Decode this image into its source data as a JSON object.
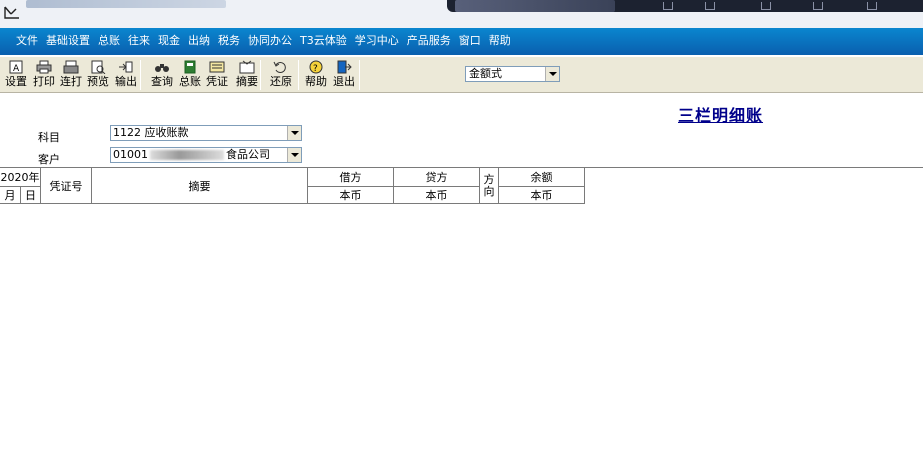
{
  "menu": {
    "items": [
      "文件",
      "基础设置",
      "总账",
      "往来",
      "现金",
      "出纳",
      "税务",
      "协同办公",
      "T3云体验",
      "学习中心",
      "产品服务",
      "窗口",
      "帮助"
    ]
  },
  "toolbar": {
    "buttons": [
      {
        "label": "设置",
        "icon": "settings-icon"
      },
      {
        "label": "打印",
        "icon": "printer-icon"
      },
      {
        "label": "连打",
        "icon": "continuous-print-icon"
      },
      {
        "label": "预览",
        "icon": "preview-icon"
      },
      {
        "label": "输出",
        "icon": "export-icon"
      },
      {
        "label": "查询",
        "icon": "binoculars-icon"
      },
      {
        "label": "总账",
        "icon": "ledger-book-icon"
      },
      {
        "label": "凭证",
        "icon": "voucher-icon"
      },
      {
        "label": "摘要",
        "icon": "summary-icon"
      },
      {
        "label": "还原",
        "icon": "restore-icon"
      },
      {
        "label": "帮助",
        "icon": "help-icon"
      },
      {
        "label": "退出",
        "icon": "exit-icon"
      }
    ]
  },
  "format_select": {
    "value": "金额式"
  },
  "report": {
    "title": "三栏明细账"
  },
  "fields": {
    "subject_label": "科目",
    "subject_value": "1122  应收账款",
    "customer_label": "客户",
    "customer_code": "01001",
    "customer_name_tail": "食品公司"
  },
  "table": {
    "year": "2020年",
    "month": "月",
    "day": "日",
    "voucher_no": "凭证号",
    "summary": "摘要",
    "debit": "借方",
    "credit": "贷方",
    "direction": "方向",
    "balance": "余额",
    "currency": "本币"
  },
  "colors": {
    "menubar": "#0a6fbd",
    "toolbar": "#ece9d8",
    "title": "#00008b"
  }
}
